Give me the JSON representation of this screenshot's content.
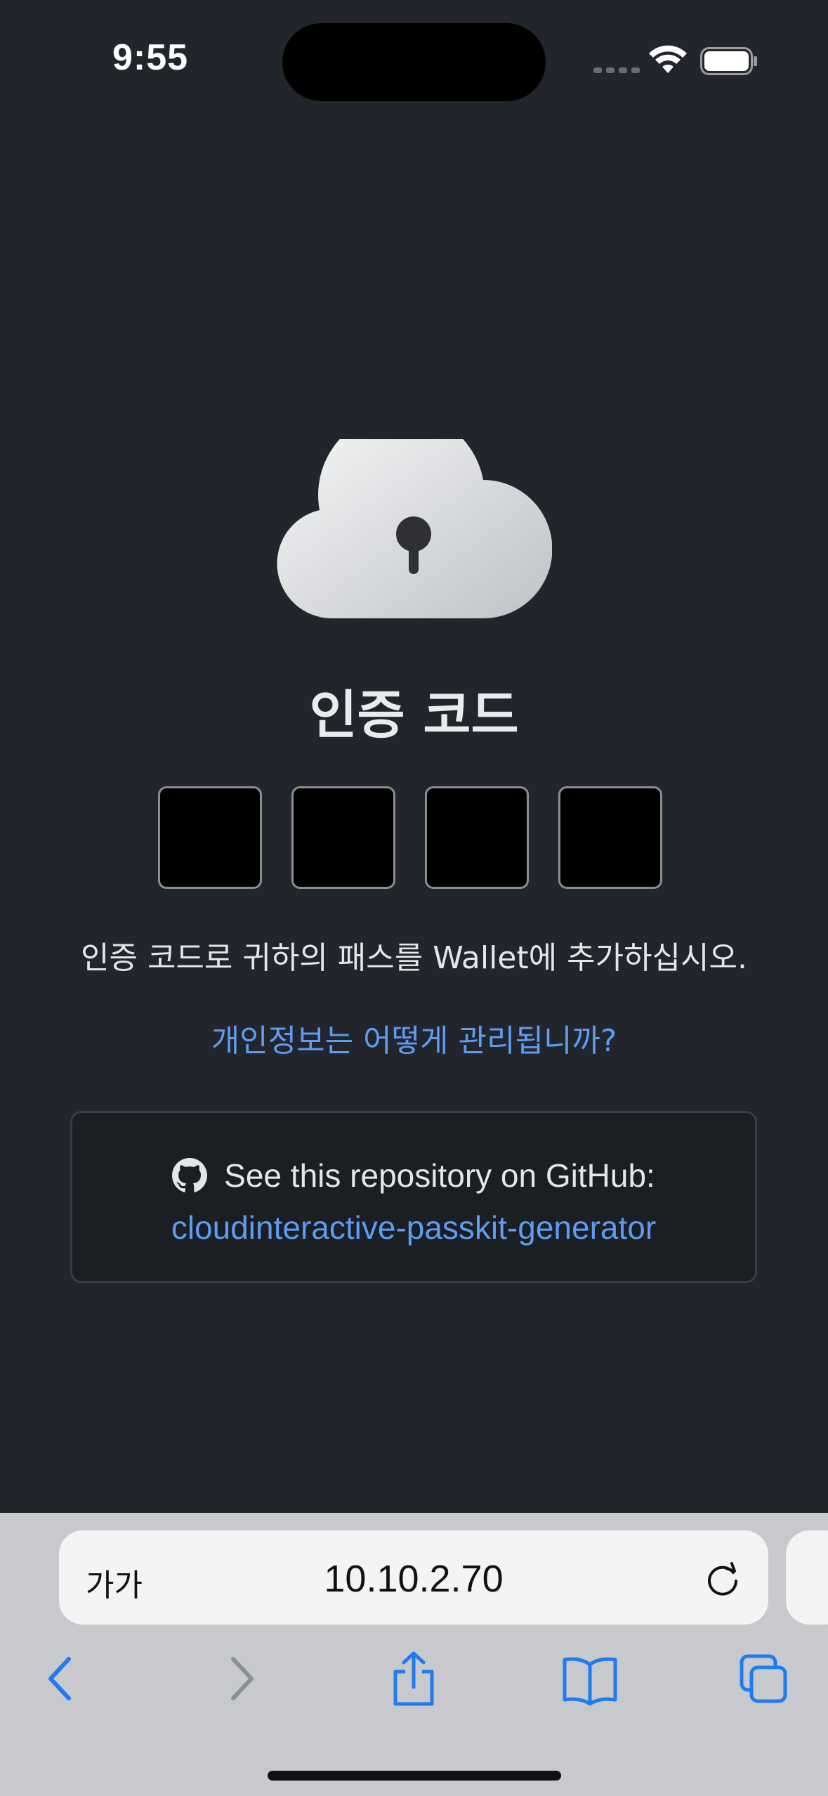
{
  "status_bar": {
    "time": "9:55",
    "wifi_icon": "wifi-icon",
    "battery_icon": "battery-icon"
  },
  "main": {
    "icon": "cloud-keyhole-icon",
    "title": "인증 코드",
    "code_inputs": [
      "",
      "",
      "",
      ""
    ],
    "description": "인증 코드로 귀하의 패스를 Wallet에 추가하십시오.",
    "privacy_link": "개인정보는 어떻게 관리됩니까?",
    "repo_card": {
      "icon": "github-icon",
      "text": "See this repository on GitHub:",
      "link": "cloudinteractive-passkit-generator"
    }
  },
  "browser": {
    "text_size_label": "가가",
    "url": "10.10.2.70",
    "reload_icon": "reload-icon",
    "toolbar": [
      "back-icon",
      "forward-icon",
      "share-icon",
      "bookmarks-icon",
      "tabs-icon"
    ]
  },
  "colors": {
    "background": "#22252b",
    "link": "#5f9bf0",
    "toolbar_blue": "#1f7cf0"
  }
}
